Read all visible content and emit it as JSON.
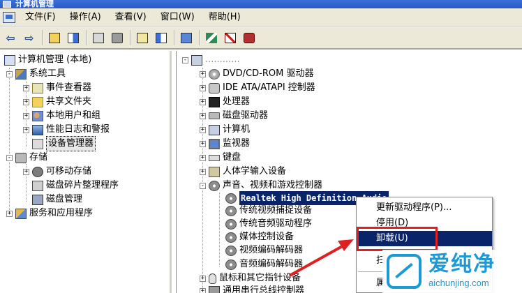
{
  "window": {
    "title": "计算机管理"
  },
  "menubar": {
    "items": [
      "文件(F)",
      "操作(A)",
      "查看(V)",
      "窗口(W)",
      "帮助(H)"
    ]
  },
  "toolbar": {
    "back_glyph": "⇦",
    "forward_glyph": "⇨"
  },
  "left_tree": {
    "root": "计算机管理 (本地)",
    "system_tools": "系统工具",
    "event_viewer": "事件查看器",
    "shared_folders": "共享文件夹",
    "local_users": "本地用户和组",
    "perf_logs": "性能日志和警报",
    "device_manager": "设备管理器",
    "storage": "存储",
    "removable_storage": "可移动存储",
    "disk_defrag": "磁盘碎片整理程序",
    "disk_management": "磁盘管理",
    "services_apps": "服务和应用程序"
  },
  "right_tree": {
    "root": "............",
    "dvd": "DVD/CD-ROM 驱动器",
    "ide": "IDE ATA/ATAPI 控制器",
    "processor": "处理器",
    "disk_drives": "磁盘驱动器",
    "computer": "计算机",
    "monitor": "监视器",
    "keyboard": "键盘",
    "hid": "人体学输入设备",
    "sound": "声音、视频和游戏控制器",
    "realtek": "Realtek High Definition Audio",
    "legacy_capture": "传统视频捕捉设备",
    "legacy_audio": "传统音频驱动程序",
    "media_control": "媒体控制设备",
    "video_codec": "视频编码解码器",
    "audio_codec": "音频编码解码器",
    "mouse": "鼠标和其它指针设备",
    "usb": "通用串行总线控制器"
  },
  "context_menu": {
    "update_driver": "更新驱动程序(P)...",
    "disable": "停用(D)",
    "uninstall": "卸载(U)",
    "scan": "扫",
    "properties": "属"
  },
  "watermark": {
    "title": "爱纯净",
    "url": "aichunjing.com"
  },
  "colors": {
    "selection": "#0a246a",
    "annotation": "#e02020",
    "watermark": "#1c9ad6"
  }
}
